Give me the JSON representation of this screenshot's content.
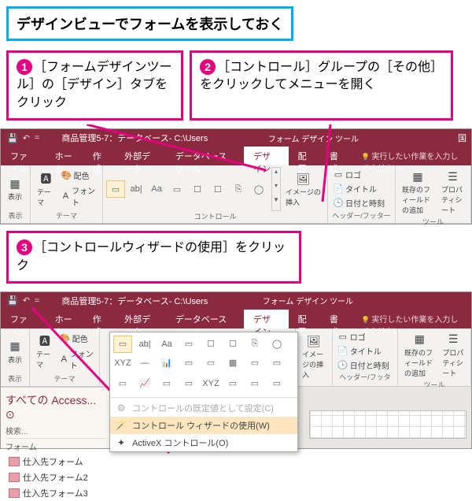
{
  "title_callout": "デザインビューでフォームを表示しておく",
  "callouts": {
    "c1": {
      "num": "1",
      "text": "［フォームデザインツール］の［デザイン］タブをクリック"
    },
    "c2": {
      "num": "2",
      "text": "［コントロール］グループの［その他］をクリックしてメニューを開く"
    },
    "c3": {
      "num": "3",
      "text": "［コントロールウィザードの使用］をクリック"
    }
  },
  "app": {
    "qat": {
      "save": "💾",
      "undo": "↶",
      "redo": "↷"
    },
    "title1": "商品管理5-7：データベース- C:\\Users",
    "title2": "商品管理5-7：データベース- C:\\Users",
    "tool_context": "フォーム デザイン ツール",
    "corner": "国",
    "tabs": {
      "file": "ファイル",
      "home": "ホーム",
      "create": "作成",
      "external": "外部データ",
      "dbtools": "データベース ツール",
      "design": "デザイン",
      "arrange": "配置",
      "format": "書式",
      "tell": "実行したい作業を入力してください"
    },
    "groups": {
      "view": "表示",
      "view_btn": "表示",
      "themes": "テーマ",
      "theme_btn": "テーマ",
      "colors": "配色",
      "fonts": "フォント",
      "controls": "コントロール",
      "image_btn": "イメージの挿入",
      "hf": "ヘッダー/フッター",
      "logo": "ロゴ",
      "title_ctrl": "タイトル",
      "datetime": "日付と時刻",
      "exist": "既存のフィールドの追加",
      "prop": "プロパティシート",
      "tools": "ツール"
    },
    "gallery_icons": [
      "▭",
      "ab|",
      "Aa",
      "▭",
      "☐",
      "☐",
      "⎘",
      "◯"
    ],
    "gallery_icons2": [
      "XYZ",
      "—",
      "📊",
      "▭",
      "▭",
      "▦",
      "▭",
      "▭",
      "▭",
      "📈",
      "▭",
      "▭",
      "XYZ",
      "▭",
      "▭",
      "▭"
    ],
    "popup_menu": {
      "set_default": "コントロールの既定値として設定(C)",
      "use_wizard": "コントロール ウィザードの使用(W)",
      "activex": "ActiveX コントロール(O)"
    },
    "nav": {
      "title": "すべての Access...",
      "search": "検索...",
      "group": "フォーム",
      "items": [
        "仕入先フォーム",
        "仕入先フォーム2",
        "仕入先フォーム3"
      ]
    }
  }
}
